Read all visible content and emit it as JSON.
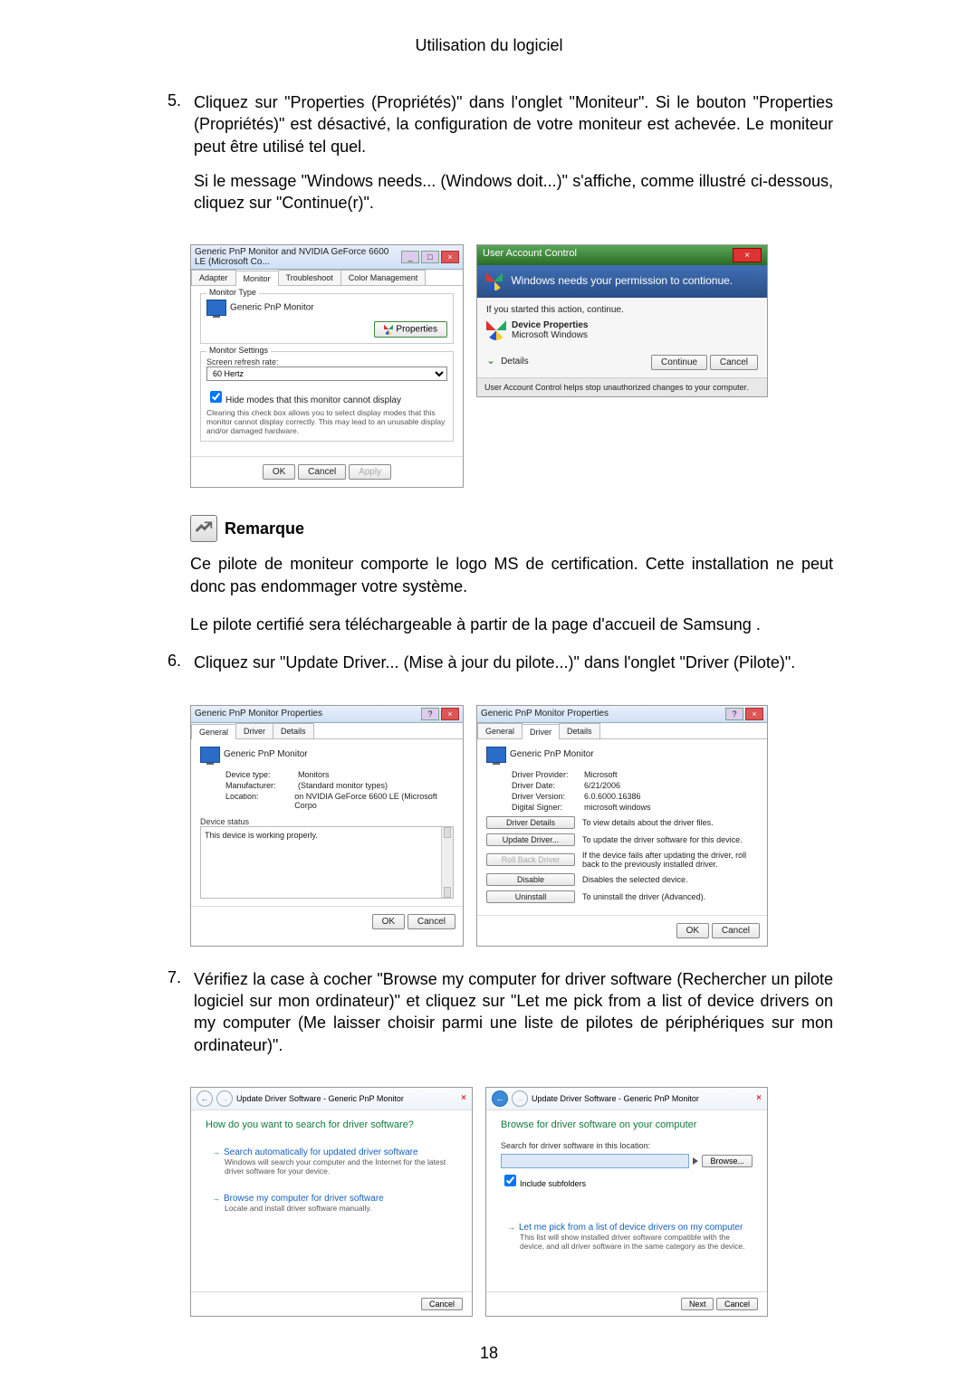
{
  "header": {
    "title": "Utilisation du logiciel"
  },
  "steps": {
    "s5": {
      "num": "5.",
      "p1": "Cliquez sur \"Properties (Propriétés)\" dans l'onglet \"Moniteur\". Si le bouton \"Properties (Propriétés)\" est désactivé, la configuration de votre moniteur est achevée. Le moniteur peut être utilisé tel quel.",
      "p2": "Si le message \"Windows needs... (Windows doit...)\" s'affiche, comme illustré ci-dessous, cliquez sur \"Continue(r)\"."
    },
    "s6": {
      "num": "6.",
      "p1": "Cliquez sur \"Update Driver... (Mise à jour du pilote...)\" dans l'onglet \"Driver (Pilote)\"."
    },
    "s7": {
      "num": "7.",
      "p1": "Vérifiez la case à cocher \"Browse my computer for driver software (Rechercher un pilote logiciel sur mon ordinateur)\" et cliquez sur \"Let me pick from a list of device drivers on my computer (Me laisser choisir parmi une liste de pilotes de périphériques sur mon ordinateur)\"."
    }
  },
  "note": {
    "label": "Remarque",
    "p1": "Ce pilote de moniteur comporte le logo MS de certification. Cette installation ne peut donc pas endommager votre système.",
    "p2": "Le pilote certifié sera téléchargeable à partir de la page d'accueil de Samsung ."
  },
  "dialog1": {
    "title": "Generic PnP Monitor and NVIDIA GeForce 6600 LE (Microsoft Co...",
    "tabs": [
      "Adapter",
      "Monitor",
      "Troubleshoot",
      "Color Management"
    ],
    "active_tab_index": 1,
    "monitor_type_label": "Monitor Type",
    "monitor_name": "Generic PnP Monitor",
    "properties_btn": "Properties",
    "settings_label": "Monitor Settings",
    "refresh_label": "Screen refresh rate:",
    "refresh_value": "60 Hertz",
    "hide_check": "Hide modes that this monitor cannot display",
    "hide_note": "Clearing this check box allows you to select display modes that this monitor cannot display correctly. This may lead to an unusable display and/or damaged hardware.",
    "ok": "OK",
    "cancel": "Cancel",
    "apply": "Apply"
  },
  "uac": {
    "title": "User Account Control",
    "blue_line": "Windows needs your permission to contionue.",
    "started_line": "If you started this action, continue.",
    "item_title": "Device Properties",
    "item_sub": "Microsoft Windows",
    "details": "Details",
    "continue": "Continue",
    "cancel": "Cancel",
    "footer": "User Account Control helps stop unauthorized changes to your computer."
  },
  "props_general": {
    "title": "Generic PnP Monitor Properties",
    "tabs": [
      "General",
      "Driver",
      "Details"
    ],
    "active_tab_index": 0,
    "device_name": "Generic PnP Monitor",
    "fields": {
      "device_type": {
        "k": "Device type:",
        "v": "Monitors"
      },
      "manufacturer": {
        "k": "Manufacturer:",
        "v": "(Standard monitor types)"
      },
      "location": {
        "k": "Location:",
        "v": "on NVIDIA GeForce 6600 LE (Microsoft Corpo"
      }
    },
    "status_label": "Device status",
    "status_text": "This device is working properly.",
    "ok": "OK",
    "cancel": "Cancel"
  },
  "props_driver": {
    "title": "Generic PnP Monitor Properties",
    "tabs": [
      "General",
      "Driver",
      "Details"
    ],
    "active_tab_index": 1,
    "device_name": "Generic PnP Monitor",
    "fields": {
      "provider": {
        "k": "Driver Provider:",
        "v": "Microsoft"
      },
      "date": {
        "k": "Driver Date:",
        "v": "6/21/2006"
      },
      "version": {
        "k": "Driver Version:",
        "v": "6.0.6000.16386"
      },
      "signer": {
        "k": "Digital Signer:",
        "v": "microsoft windows"
      }
    },
    "buttons": {
      "details": {
        "b": "Driver Details",
        "d": "To view details about the driver files."
      },
      "update": {
        "b": "Update Driver...",
        "d": "To update the driver software for this device."
      },
      "rollback": {
        "b": "Roll Back Driver",
        "d": "If the device fails after updating the driver, roll back to the previously installed driver."
      },
      "disable": {
        "b": "Disable",
        "d": "Disables the selected device."
      },
      "uninstall": {
        "b": "Uninstall",
        "d": "To uninstall the driver (Advanced)."
      }
    },
    "ok": "OK",
    "cancel": "Cancel"
  },
  "wizard1": {
    "crumb": "Update Driver Software - Generic PnP Monitor",
    "heading": "How do you want to search for driver software?",
    "opt1_title": "Search automatically for updated driver software",
    "opt1_desc": "Windows will search your computer and the Internet for the latest driver software for your device.",
    "opt2_title": "Browse my computer for driver software",
    "opt2_desc": "Locate and install driver software manually.",
    "cancel": "Cancel"
  },
  "wizard2": {
    "crumb": "Update Driver Software - Generic PnP Monitor",
    "heading": "Browse for driver software on your computer",
    "search_label": "Search for driver software in this location:",
    "browse": "Browse...",
    "include": "Include subfolders",
    "opt_title": "Let me pick from a list of device drivers on my computer",
    "opt_desc": "This list will show installed driver software compatible with the device, and all driver software in the same category as the device.",
    "next": "Next",
    "cancel": "Cancel"
  },
  "page_number": "18"
}
